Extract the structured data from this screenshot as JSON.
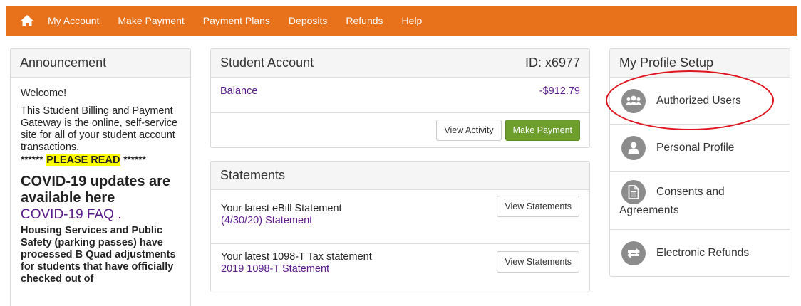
{
  "nav": {
    "items": [
      "My Account",
      "Make Payment",
      "Payment Plans",
      "Deposits",
      "Refunds",
      "Help"
    ]
  },
  "announcement": {
    "title": "Announcement",
    "welcome": "Welcome!",
    "intro": "This Student Billing and Payment Gateway is the online, self-service site for all of your student account transactions.",
    "read_prefix": "******",
    "read_highlight": "PLEASE READ",
    "read_suffix": "******",
    "covid_heading": "COVID-19 updates are available here",
    "covid_link": "COVID-19 FAQ",
    "covid_link_suffix": " .",
    "housing": "Housing Services and Public Safety (parking passes) have processed B Quad adjustments for students that have officially checked out of"
  },
  "account": {
    "title": "Student Account",
    "id_label": "ID: x6977",
    "balance_label": "Balance",
    "balance_value": "-$912.79",
    "view_activity": "View Activity",
    "make_payment": "Make Payment"
  },
  "statements": {
    "title": "Statements",
    "rows": [
      {
        "text": "Your latest eBill Statement",
        "link": "(4/30/20) Statement",
        "button": "View Statements"
      },
      {
        "text": "Your latest 1098-T Tax statement",
        "link": "2019 1098-T Statement",
        "button": "View Statements"
      }
    ]
  },
  "profile": {
    "title": "My Profile Setup",
    "items": [
      {
        "label": "Authorized Users",
        "icon": "users-icon"
      },
      {
        "label": "Personal Profile",
        "icon": "user-icon"
      },
      {
        "label": "Consents and",
        "label2": "Agreements",
        "icon": "document-icon"
      },
      {
        "label": "Electronic Refunds",
        "icon": "refresh-icon"
      }
    ]
  },
  "colors": {
    "nav": "#e8711c",
    "link": "#5b1a8a",
    "button_green": "#6e9e2c",
    "highlight": "#ffff00",
    "annotation_oval": "#e0141e"
  }
}
